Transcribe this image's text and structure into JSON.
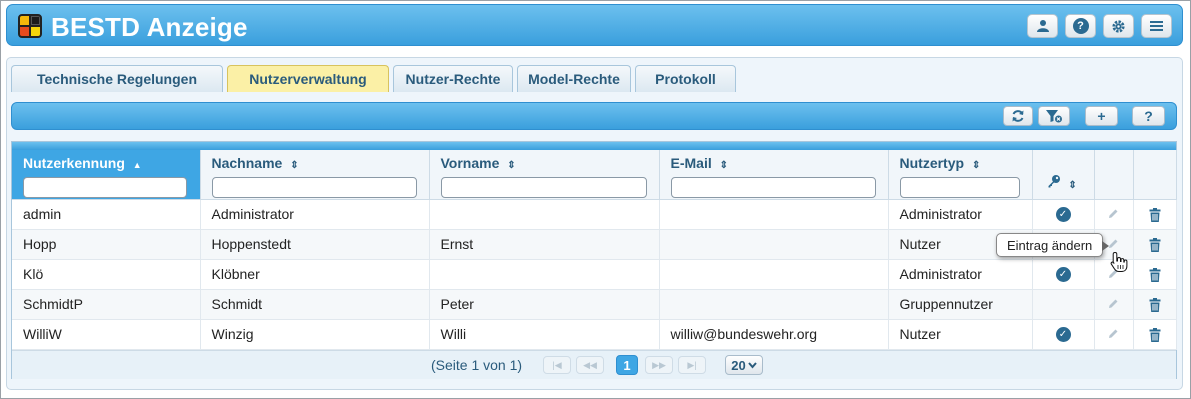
{
  "header": {
    "title": "BESTD Anzeige",
    "buttons": [
      "user-icon",
      "help-icon",
      "gear-icon",
      "menu-icon"
    ]
  },
  "tabs": [
    {
      "label": "Technische Regelungen",
      "active": false
    },
    {
      "label": "Nutzerverwaltung",
      "active": true
    },
    {
      "label": "Nutzer-Rechte",
      "active": false
    },
    {
      "label": "Model-Rechte",
      "active": false
    },
    {
      "label": "Protokoll",
      "active": false
    }
  ],
  "toolbar": {
    "buttons": [
      "refresh-icon",
      "clear-filter-icon",
      "plus-icon",
      "help-icon"
    ],
    "add_label": "+",
    "help_label": "?"
  },
  "table": {
    "columns": [
      "Nutzerkennung",
      "Nachname",
      "Vorname",
      "E-Mail",
      "Nutzertyp"
    ],
    "sorted_column": "Nutzerkennung",
    "rows": [
      {
        "kennung": "admin",
        "nachname": "Administrator",
        "vorname": "",
        "email": "",
        "typ": "Administrator",
        "key": true
      },
      {
        "kennung": "Hopp",
        "nachname": "Hoppenstedt",
        "vorname": "Ernst",
        "email": "",
        "typ": "Nutzer",
        "key": false
      },
      {
        "kennung": "Klö",
        "nachname": "Klöbner",
        "vorname": "",
        "email": "",
        "typ": "Administrator",
        "key": true
      },
      {
        "kennung": "SchmidtP",
        "nachname": "Schmidt",
        "vorname": "Peter",
        "email": "",
        "typ": "Gruppennutzer",
        "key": false
      },
      {
        "kennung": "WilliW",
        "nachname": "Winzig",
        "vorname": "Willi",
        "email": "williw@bundeswehr.org",
        "typ": "Nutzer",
        "key": true
      }
    ]
  },
  "pager": {
    "text": "(Seite 1 von 1)",
    "current_page": "1",
    "page_size": "20"
  },
  "tooltip": {
    "text": "Eintrag ändern"
  },
  "colors": {
    "header_blue": "#3a9fdd",
    "active_tab": "#fbf0a6",
    "icon_dark": "#2b6a91"
  }
}
